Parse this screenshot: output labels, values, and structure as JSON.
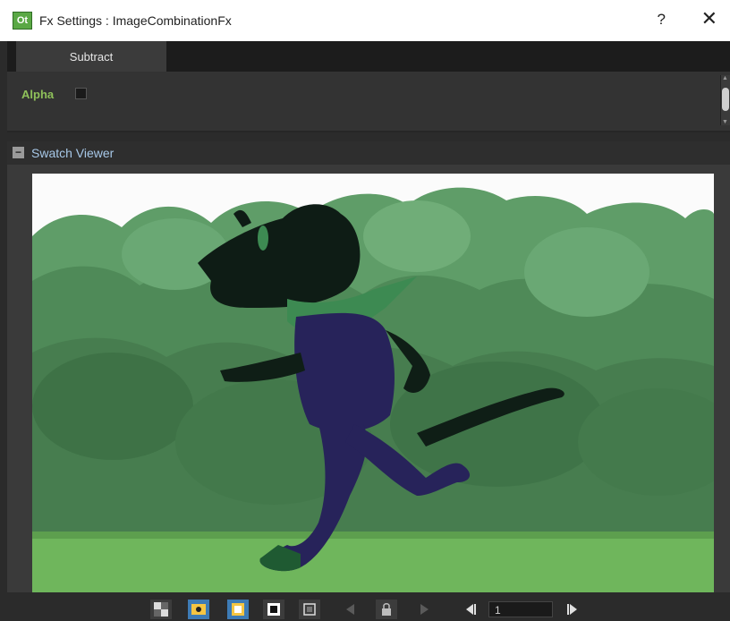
{
  "window": {
    "app_icon_text": "Ot",
    "title": "Fx Settings : ImageCombinationFx",
    "help_label": "?",
    "close_label": "✕"
  },
  "tabs": [
    {
      "label": "Subtract",
      "active": true
    }
  ],
  "params": {
    "alpha": {
      "label": "Alpha",
      "checked": false
    }
  },
  "swatch_viewer": {
    "collapse_symbol": "−",
    "title": "Swatch Viewer"
  },
  "toolbar": {
    "buttons": [
      {
        "icon": "checkerboard-icon",
        "active": false
      },
      {
        "icon": "eye-icon",
        "active": true
      },
      {
        "icon": "white-background-icon",
        "active": true
      },
      {
        "icon": "black-background-icon",
        "active": false
      },
      {
        "icon": "frame-icon",
        "active": false
      },
      {
        "icon": "previous-icon",
        "active": false
      },
      {
        "icon": "lock-icon",
        "active": false
      },
      {
        "icon": "next-icon",
        "active": false
      },
      {
        "icon": "first-frame-icon",
        "active": false
      },
      {
        "icon": "last-frame-icon",
        "active": false
      }
    ],
    "frame_value": "1"
  },
  "colors": {
    "accent_blue": "#3d7bb5",
    "label_green": "#8fc15a",
    "header_blue": "#a7c8e8",
    "panel_dark": "#2b2b2b"
  }
}
